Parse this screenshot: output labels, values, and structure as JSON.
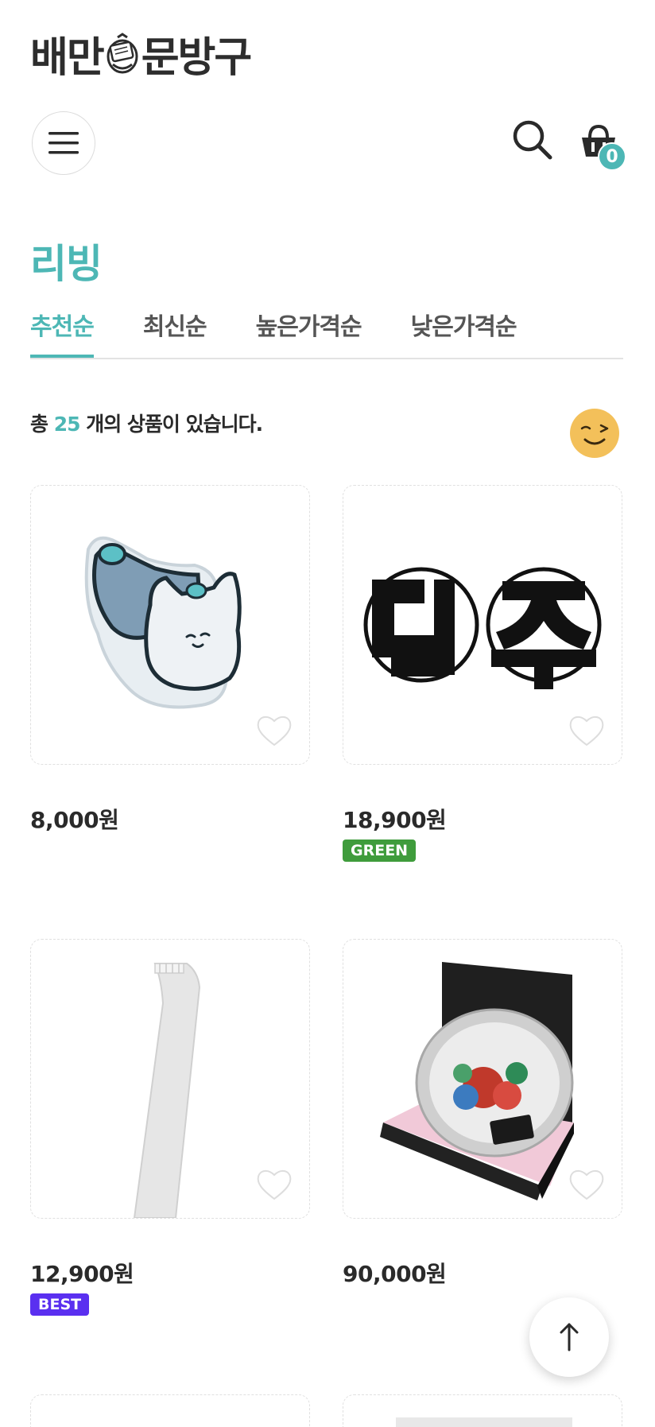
{
  "header": {
    "logo_text_left": "배만",
    "logo_text_right": "문방구",
    "cart_count": "0"
  },
  "category": {
    "title": "리빙"
  },
  "sort_tabs": [
    {
      "label": "추천순",
      "active": true
    },
    {
      "label": "최신순",
      "active": false
    },
    {
      "label": "높은가격순",
      "active": false
    },
    {
      "label": "낮은가격순",
      "active": false
    }
  ],
  "summary": {
    "prefix": "총 ",
    "count": "25",
    "suffix": " 개의 상품이 있습니다."
  },
  "products": [
    {
      "price": "8,000원",
      "badge": "",
      "art": "acrylic-cat-stand"
    },
    {
      "price": "18,900원",
      "badge": "GREEN",
      "art": "mac-ju-coasters"
    },
    {
      "price": "12,900원",
      "badge": "BEST",
      "art": "white-shoehorn"
    },
    {
      "price": "90,000원",
      "badge": "",
      "art": "round-tray-gift-box"
    }
  ],
  "colors": {
    "accent": "#4db7b5",
    "badge_green": "#3f9c3c",
    "badge_best": "#5a2ff0",
    "emoji_yellow": "#f3c05a"
  },
  "icons": {
    "menu": "hamburger-icon",
    "search": "search-icon",
    "cart": "basket-icon",
    "wishlist": "heart-icon",
    "scroll_top": "arrow-up-icon",
    "emoji": "wink-face-icon"
  }
}
